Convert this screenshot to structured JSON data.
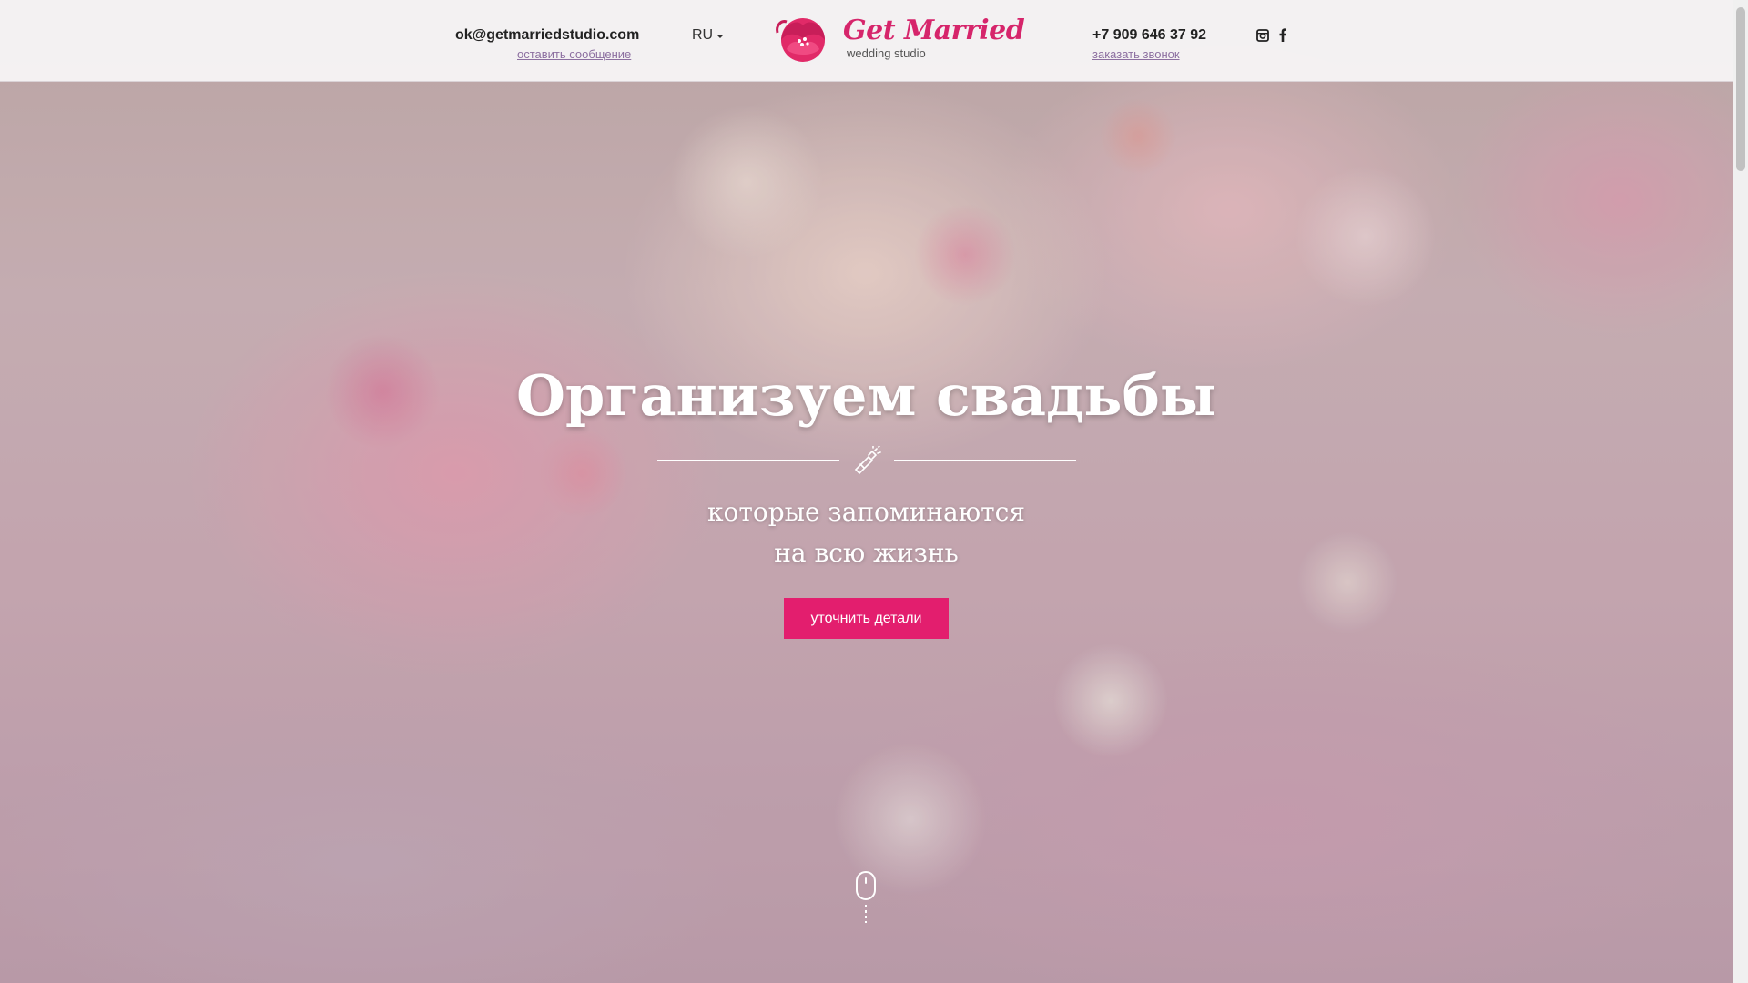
{
  "header": {
    "email": "ok@getmarriedstudio.com",
    "message_link": "оставить сообщение",
    "language": "RU",
    "logo_title": "Get Married",
    "logo_subtitle": "wedding studio",
    "phone": "+7 909 646 37 92",
    "call_link": "заказать звонок",
    "social": [
      "instagram-icon",
      "facebook-icon"
    ]
  },
  "hero": {
    "headline": "Организуем свадьбы",
    "subline_1": "которые запоминаются",
    "subline_2": "на всю жизнь",
    "cta_label": "уточнить детали"
  },
  "colors": {
    "accent": "#e31e6e",
    "link": "#8c6fa0",
    "logo": "#d6256b"
  }
}
